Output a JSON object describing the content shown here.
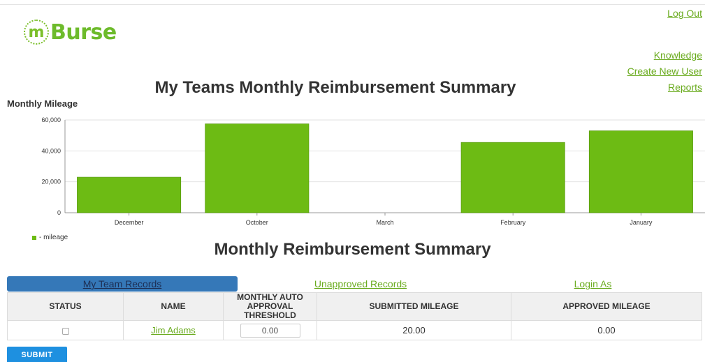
{
  "header": {
    "logo_mark": "m",
    "logo_text": "Burse",
    "logout": "Log Out"
  },
  "nav": {
    "knowledge": "Knowledge",
    "create_user": "Create New User",
    "reports": "Reports"
  },
  "main": {
    "title": "My Teams Monthly Reimbursement Summary",
    "chart_label": "Monthly Mileage",
    "legend_label": "- mileage",
    "subtitle": "Monthly Reimbursement Summary"
  },
  "chart_data": {
    "type": "bar",
    "title": "",
    "xlabel": "",
    "ylabel": "Monthly Mileage",
    "categories": [
      "December",
      "October",
      "March",
      "February",
      "January"
    ],
    "series": [
      {
        "name": "mileage",
        "values": [
          23000,
          57500,
          0,
          45500,
          53000
        ]
      }
    ],
    "ylim": [
      0,
      60000
    ],
    "yticks": [
      0,
      20000,
      40000,
      60000
    ],
    "ytick_labels": [
      "0",
      "20,000",
      "40,000",
      "60,000"
    ],
    "grid": true,
    "legend": "bottom-left",
    "color": "#6dbb14"
  },
  "tabs": [
    {
      "label": "My Team Records",
      "active": true
    },
    {
      "label": "Unapproved Records",
      "active": false
    },
    {
      "label": "Login As",
      "active": false
    }
  ],
  "table": {
    "headers": {
      "status": "STATUS",
      "name": "NAME",
      "threshold_line1": "MONTHLY AUTO",
      "threshold_line2": "APPROVAL THRESHOLD",
      "submitted": "SUBMITTED MILEAGE",
      "approved": "APPROVED MILEAGE"
    },
    "rows": [
      {
        "name": "Jim Adams",
        "threshold": "0.00",
        "submitted": "20.00",
        "approved": "0.00"
      }
    ]
  },
  "submit_label": "SUBMIT",
  "colors": {
    "accent": "#6aab1e",
    "tab_active": "#3578b8",
    "submit": "#1e90e0"
  }
}
